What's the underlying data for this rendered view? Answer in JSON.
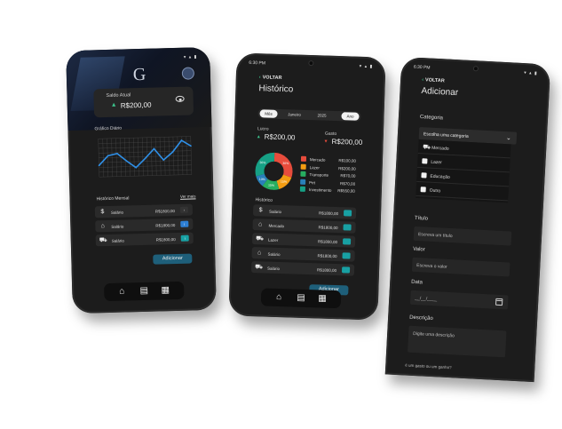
{
  "status": {
    "time": "6:30 PM",
    "icons": "▾ ▴ ▮"
  },
  "home": {
    "logo": "G",
    "saldo_label": "Saldo Atual",
    "saldo_value": "R$200,00",
    "chart_title": "Gráfico Diário",
    "history_title": "Histórico Mensal",
    "ver_mais": "Ver mais",
    "rows": [
      {
        "icon": "$",
        "label": "Salário",
        "value": "R$1800,00",
        "tag": "›"
      },
      {
        "icon": "⌂",
        "label": "Salário",
        "value": "R$1800,00",
        "tag": "i"
      },
      {
        "icon": "⛟",
        "label": "Salário",
        "value": "R$1800,00",
        "tag": "i"
      }
    ],
    "add_button": "Adicionar"
  },
  "chart_data": {
    "type": "line",
    "title": "Gráfico Diário",
    "x": [
      "",
      "",
      "",
      "",
      "",
      "",
      "",
      "",
      "",
      "",
      ""
    ],
    "series": [
      {
        "values": [
          30,
          55,
          60,
          40,
          22,
          45,
          70,
          40,
          60,
          90,
          75
        ]
      }
    ],
    "ylim": [
      0,
      100
    ],
    "grid": true
  },
  "history": {
    "back": "VOLTAR",
    "title": "Histórico",
    "toggle": {
      "month": "Mês",
      "year": "Ano"
    },
    "selected_month": "Janeiro",
    "selected_year": "2025",
    "lucro_label": "Lucro",
    "lucro_value": "R$200,00",
    "gasto_label": "Gasto",
    "gasto_value": "R$200,00",
    "donut": [
      {
        "name": "Mercado",
        "value": "R$100,00",
        "pct": 30,
        "label": "30%",
        "color": "#e74c3c"
      },
      {
        "name": "Lazer",
        "value": "R$200,00",
        "pct": 15,
        "label": "15%",
        "color": "#f39c12"
      },
      {
        "name": "Transporte",
        "value": "R$70,00",
        "pct": 15,
        "label": "15%",
        "color": "#27ae60"
      },
      {
        "name": "Pet",
        "value": "R$70,00",
        "pct": 10,
        "label": "10%",
        "color": "#2980b9"
      },
      {
        "name": "Investimento",
        "value": "R$550,00",
        "pct": 30,
        "label": "30%",
        "color": "#16a085"
      }
    ],
    "list_title": "Histórico",
    "rows": [
      {
        "icon": "$",
        "label": "Salário",
        "value": "R$1800,00"
      },
      {
        "icon": "⌂",
        "label": "Mercado",
        "value": "R$1800,00"
      },
      {
        "icon": "⛟",
        "label": "Lazer",
        "value": "R$1800,00"
      },
      {
        "icon": "⌂",
        "label": "Salário",
        "value": "R$1800,00"
      },
      {
        "icon": "⛟",
        "label": "Salário",
        "value": "R$1800,00"
      }
    ],
    "add_button": "Adicionar"
  },
  "form": {
    "back": "VOLTAR",
    "title": "Adicionar",
    "category_label": "Categoria",
    "category_placeholder": "Escolha uma categoria",
    "options": [
      "Mercado",
      "Lazer",
      "Educação",
      "Outro"
    ],
    "titulo_label": "Título",
    "titulo_placeholder": "Escreva um título",
    "valor_label": "Valor",
    "valor_placeholder": "Escreva o valor",
    "data_label": "Data",
    "data_placeholder": "__/__/____",
    "descricao_label": "Descrição",
    "descricao_placeholder": "Digite uma descrição",
    "footnote": "é um gasto ou um ganho?"
  }
}
